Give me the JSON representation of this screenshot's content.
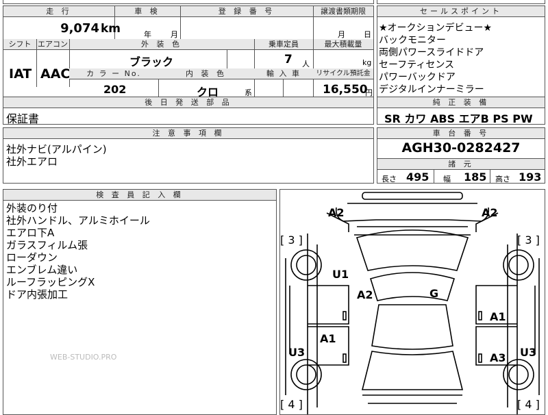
{
  "top": {
    "mileage_header": "走 行",
    "mileage_value": "9,074",
    "mileage_unit": "km",
    "inspection_header": "車 検",
    "inspection_year_label": "年",
    "inspection_month_label": "月",
    "registration_header": "登 録 番 号",
    "transfer_header": "譲渡書類期限",
    "transfer_month_label": "月",
    "transfer_day_label": "日",
    "shift_header": "シフト",
    "shift_value": "IAT",
    "ac_header": "エアコン",
    "ac_value": "AAC",
    "exterior_header": "外 装 色",
    "exterior_value": "ブラック",
    "capacity_header": "乗車定員",
    "capacity_value": "7",
    "capacity_unit": "人",
    "payload_header": "最大積載量",
    "payload_unit": "kg",
    "color_no_header": "カ ラ ー No.",
    "color_no_value": "202",
    "interior_header": "内 装 色",
    "interior_value": "クロ",
    "interior_suffix": "系",
    "import_header": "輸 入 車",
    "recycle_header": "リサイクル預託金",
    "recycle_value": "16,550",
    "recycle_unit": "円",
    "later_header": "後 日 発 送 部 品",
    "later_value": "保証書"
  },
  "selling_points": {
    "header": "セールスポイント",
    "items": [
      "★オークションデビュー★",
      "バックモニター",
      "両側パワースライドドア",
      "セーフティセンス",
      "パワーバックドア",
      "デジタルインナーミラー"
    ]
  },
  "equipment": {
    "header": "純 正 装 備",
    "value": "SR カワ ABS エアB PS PW"
  },
  "notes": {
    "header": "注 意 事 項 欄",
    "items": [
      "社外ナビ(アルパイン)",
      "社外エアロ"
    ]
  },
  "chassis": {
    "header": "車 台 番 号",
    "value": "AGH30-0282427",
    "specs_header": "諸 元",
    "length_label": "長さ",
    "length_value": "495",
    "width_label": "幅",
    "width_value": "185",
    "height_label": "高さ",
    "height_value": "193"
  },
  "inspector": {
    "header": "検 査 員 記 入 欄",
    "items": [
      "外装のり付",
      "社外ハンドル、アルミホイール",
      "エアロ下A",
      "ガラスフィルム張",
      "ローダウン",
      "エンブレム違い",
      "ルーフラッピングX",
      "ドア内張加工"
    ]
  },
  "watermark": "WEB-STUDIO.PRO",
  "diagram": {
    "marks": {
      "a2_front_left": "A2",
      "a2_front_right": "A2",
      "u1": "U1",
      "a2_hood": "A2",
      "g_windshield": "G",
      "a1_right": "A1",
      "a1_left": "A1",
      "u3_left": "U3",
      "a3_right": "A3",
      "u3_right": "U3"
    },
    "brackets": {
      "front_left": "[ 3 ]",
      "front_right": "[ 3 ]",
      "rear_left": "[ 4 ]",
      "rear_right": "[ 4 ]"
    }
  }
}
